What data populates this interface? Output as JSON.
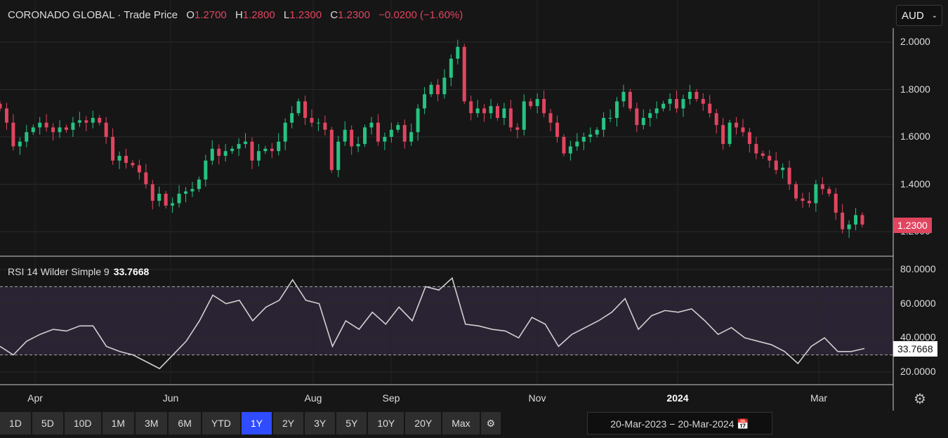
{
  "header": {
    "name": "CORONADO GLOBAL",
    "sep": "·",
    "series": "Trade Price",
    "o_label": "O",
    "o": "1.2700",
    "h_label": "H",
    "h": "1.2800",
    "l_label": "L",
    "l": "1.2300",
    "c_label": "C",
    "c": "1.2300",
    "change": "−0.0200 (−1.60%)"
  },
  "currency": {
    "value": "AUD",
    "icon": "chevron-down-icon"
  },
  "rsi": {
    "label": "RSI 14 Wilder Simple 9",
    "value": "33.7668"
  },
  "colors": {
    "up": "#26c281",
    "down": "#e0455f",
    "rsi": "#d0d0d0",
    "band": "#2a2333"
  },
  "chart_data": [
    {
      "type": "candlestick",
      "title": "CORONADO GLOBAL - Trade Price",
      "ylim": [
        1.15,
        2.02
      ],
      "yticks": [
        "2.0000",
        "1.8000",
        "1.6000",
        "1.4000",
        "1.2000"
      ],
      "last": "1.2300",
      "last_open": 1.27,
      "closes": [
        1.72,
        1.66,
        1.56,
        1.58,
        1.62,
        1.64,
        1.66,
        1.64,
        1.62,
        1.64,
        1.63,
        1.66,
        1.67,
        1.66,
        1.68,
        1.66,
        1.6,
        1.5,
        1.52,
        1.49,
        1.48,
        1.45,
        1.4,
        1.33,
        1.36,
        1.31,
        1.32,
        1.36,
        1.37,
        1.38,
        1.42,
        1.5,
        1.55,
        1.52,
        1.54,
        1.55,
        1.57,
        1.58,
        1.5,
        1.54,
        1.55,
        1.54,
        1.58,
        1.66,
        1.7,
        1.75,
        1.68,
        1.66,
        1.66,
        1.63,
        1.46,
        1.58,
        1.63,
        1.56,
        1.57,
        1.64,
        1.66,
        1.58,
        1.6,
        1.63,
        1.65,
        1.58,
        1.62,
        1.72,
        1.78,
        1.82,
        1.78,
        1.85,
        1.93,
        1.98,
        1.75,
        1.7,
        1.72,
        1.7,
        1.73,
        1.68,
        1.72,
        1.64,
        1.63,
        1.75,
        1.73,
        1.76,
        1.7,
        1.66,
        1.6,
        1.53,
        1.56,
        1.58,
        1.6,
        1.61,
        1.63,
        1.68,
        1.68,
        1.75,
        1.79,
        1.72,
        1.65,
        1.68,
        1.7,
        1.72,
        1.74,
        1.76,
        1.72,
        1.76,
        1.79,
        1.76,
        1.74,
        1.7,
        1.65,
        1.57,
        1.66,
        1.64,
        1.62,
        1.57,
        1.53,
        1.52,
        1.5,
        1.46,
        1.47,
        1.4,
        1.34,
        1.33,
        1.32,
        1.4,
        1.38,
        1.36,
        1.28,
        1.21,
        1.23,
        1.27,
        1.23
      ]
    },
    {
      "type": "line",
      "title": "RSI 14 Wilder Simple 9",
      "ylim": [
        15,
        85
      ],
      "yticks": [
        "80.0000",
        "60.0000",
        "40.0000",
        "20.0000"
      ],
      "band": [
        30,
        70
      ],
      "last": "33.7668",
      "values": [
        35,
        30,
        38,
        42,
        45,
        44,
        47,
        47,
        35,
        32,
        30,
        26,
        22,
        30,
        38,
        50,
        65,
        60,
        62,
        50,
        58,
        62,
        74,
        62,
        60,
        35,
        50,
        45,
        55,
        48,
        58,
        50,
        70,
        68,
        75,
        48,
        47,
        45,
        44,
        40,
        52,
        48,
        35,
        42,
        46,
        50,
        55,
        63,
        45,
        53,
        56,
        55,
        57,
        50,
        42,
        46,
        40,
        38,
        36,
        32,
        25,
        35,
        40,
        32,
        32,
        33.77
      ]
    }
  ],
  "xaxis": {
    "labels": [
      "Apr",
      "Jun",
      "Aug",
      "Sep",
      "Nov",
      "2024",
      "Mar"
    ]
  },
  "ranges": [
    "1D",
    "5D",
    "10D",
    "1M",
    "3M",
    "6M",
    "YTD",
    "1Y",
    "2Y",
    "3Y",
    "5Y",
    "10Y",
    "20Y",
    "Max"
  ],
  "selected_range": "1Y",
  "date_range": {
    "from": "20-Mar-2023",
    "sep": "−",
    "to": "20-Mar-2024"
  }
}
